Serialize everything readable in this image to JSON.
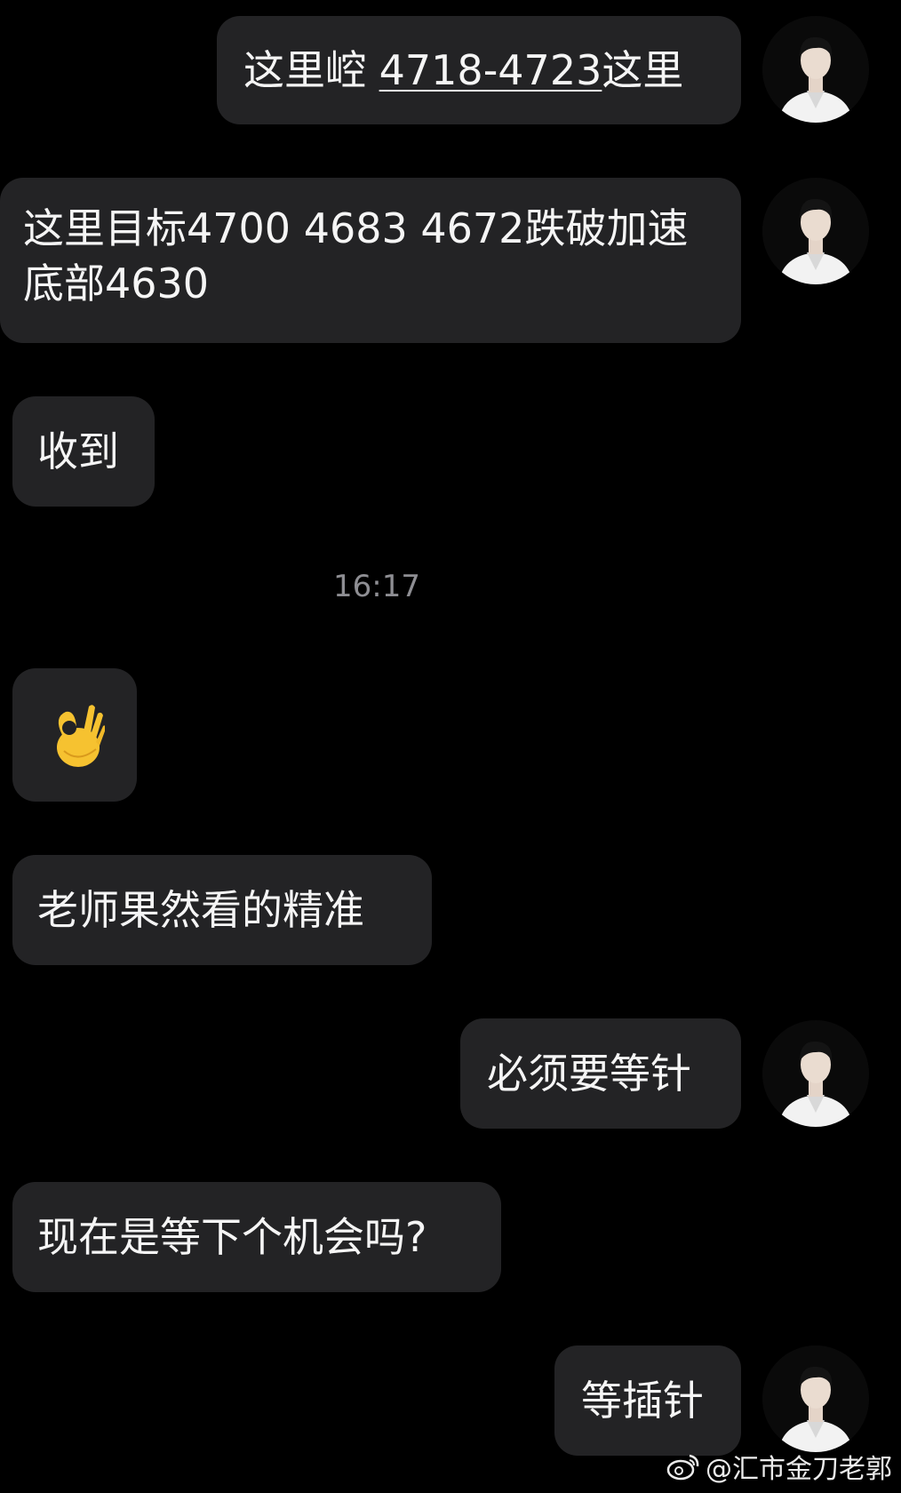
{
  "messages": [
    {
      "direction": "outgoing",
      "parts": [
        "这里崆 ",
        "4718-4723",
        "这里"
      ]
    },
    {
      "direction": "outgoing",
      "text": "这里目标4700  4683 4672跌破加速 底部4630"
    },
    {
      "direction": "incoming",
      "text": "收到"
    },
    {
      "direction": "incoming",
      "emoji": "👌"
    },
    {
      "direction": "incoming",
      "text": "老师果然看的精准"
    },
    {
      "direction": "outgoing",
      "text": "必须要等针"
    },
    {
      "direction": "incoming",
      "text": "现在是等下个机会吗?"
    },
    {
      "direction": "outgoing",
      "text": "等插针"
    }
  ],
  "timestamp": "16:17",
  "watermark": {
    "icon": "weibo-icon",
    "text": "@汇市金刀老郭"
  },
  "colors": {
    "background": "#000000",
    "bubble": "#232325",
    "text": "#f5f5f5",
    "timestamp": "#8e8e93"
  }
}
